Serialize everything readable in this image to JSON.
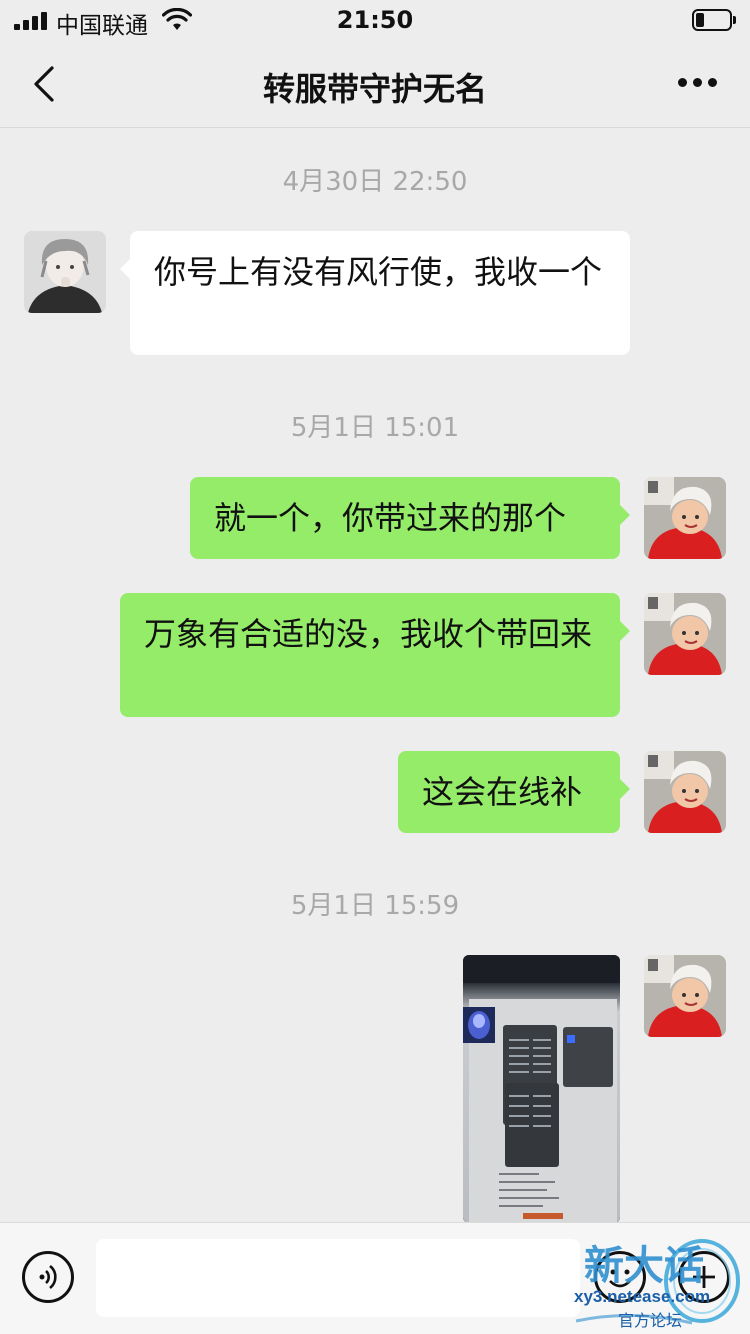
{
  "status_bar": {
    "carrier": "中国联通",
    "time": "21:50"
  },
  "nav": {
    "title": "转服带守护无名"
  },
  "messages": [
    {
      "type": "time",
      "text": "4月30日 22:50"
    },
    {
      "type": "recv",
      "text": "你号上有没有风行使，我收一个"
    },
    {
      "type": "time",
      "text": "5月1日 15:01"
    },
    {
      "type": "sent",
      "text": "就一个，你带过来的那个"
    },
    {
      "type": "sent",
      "text": "万象有合适的没，我收个带回来"
    },
    {
      "type": "sent",
      "text": "这会在线补"
    },
    {
      "type": "time",
      "text": "5月1日 15:59"
    },
    {
      "type": "sent-image",
      "text": ""
    }
  ],
  "watermark": {
    "site": "xy3.netease.com",
    "sub": "官方论坛",
    "logo": "新大话"
  },
  "colors": {
    "background": "#ededed",
    "sent_bubble": "#95ec69",
    "recv_bubble": "#ffffff",
    "timestamp": "#a8a8a8"
  },
  "icons": {
    "back": "chevron-left-icon",
    "more": "more-dots-icon",
    "voice": "voice-icon",
    "emoji": "emoji-icon",
    "plus": "plus-icon"
  }
}
